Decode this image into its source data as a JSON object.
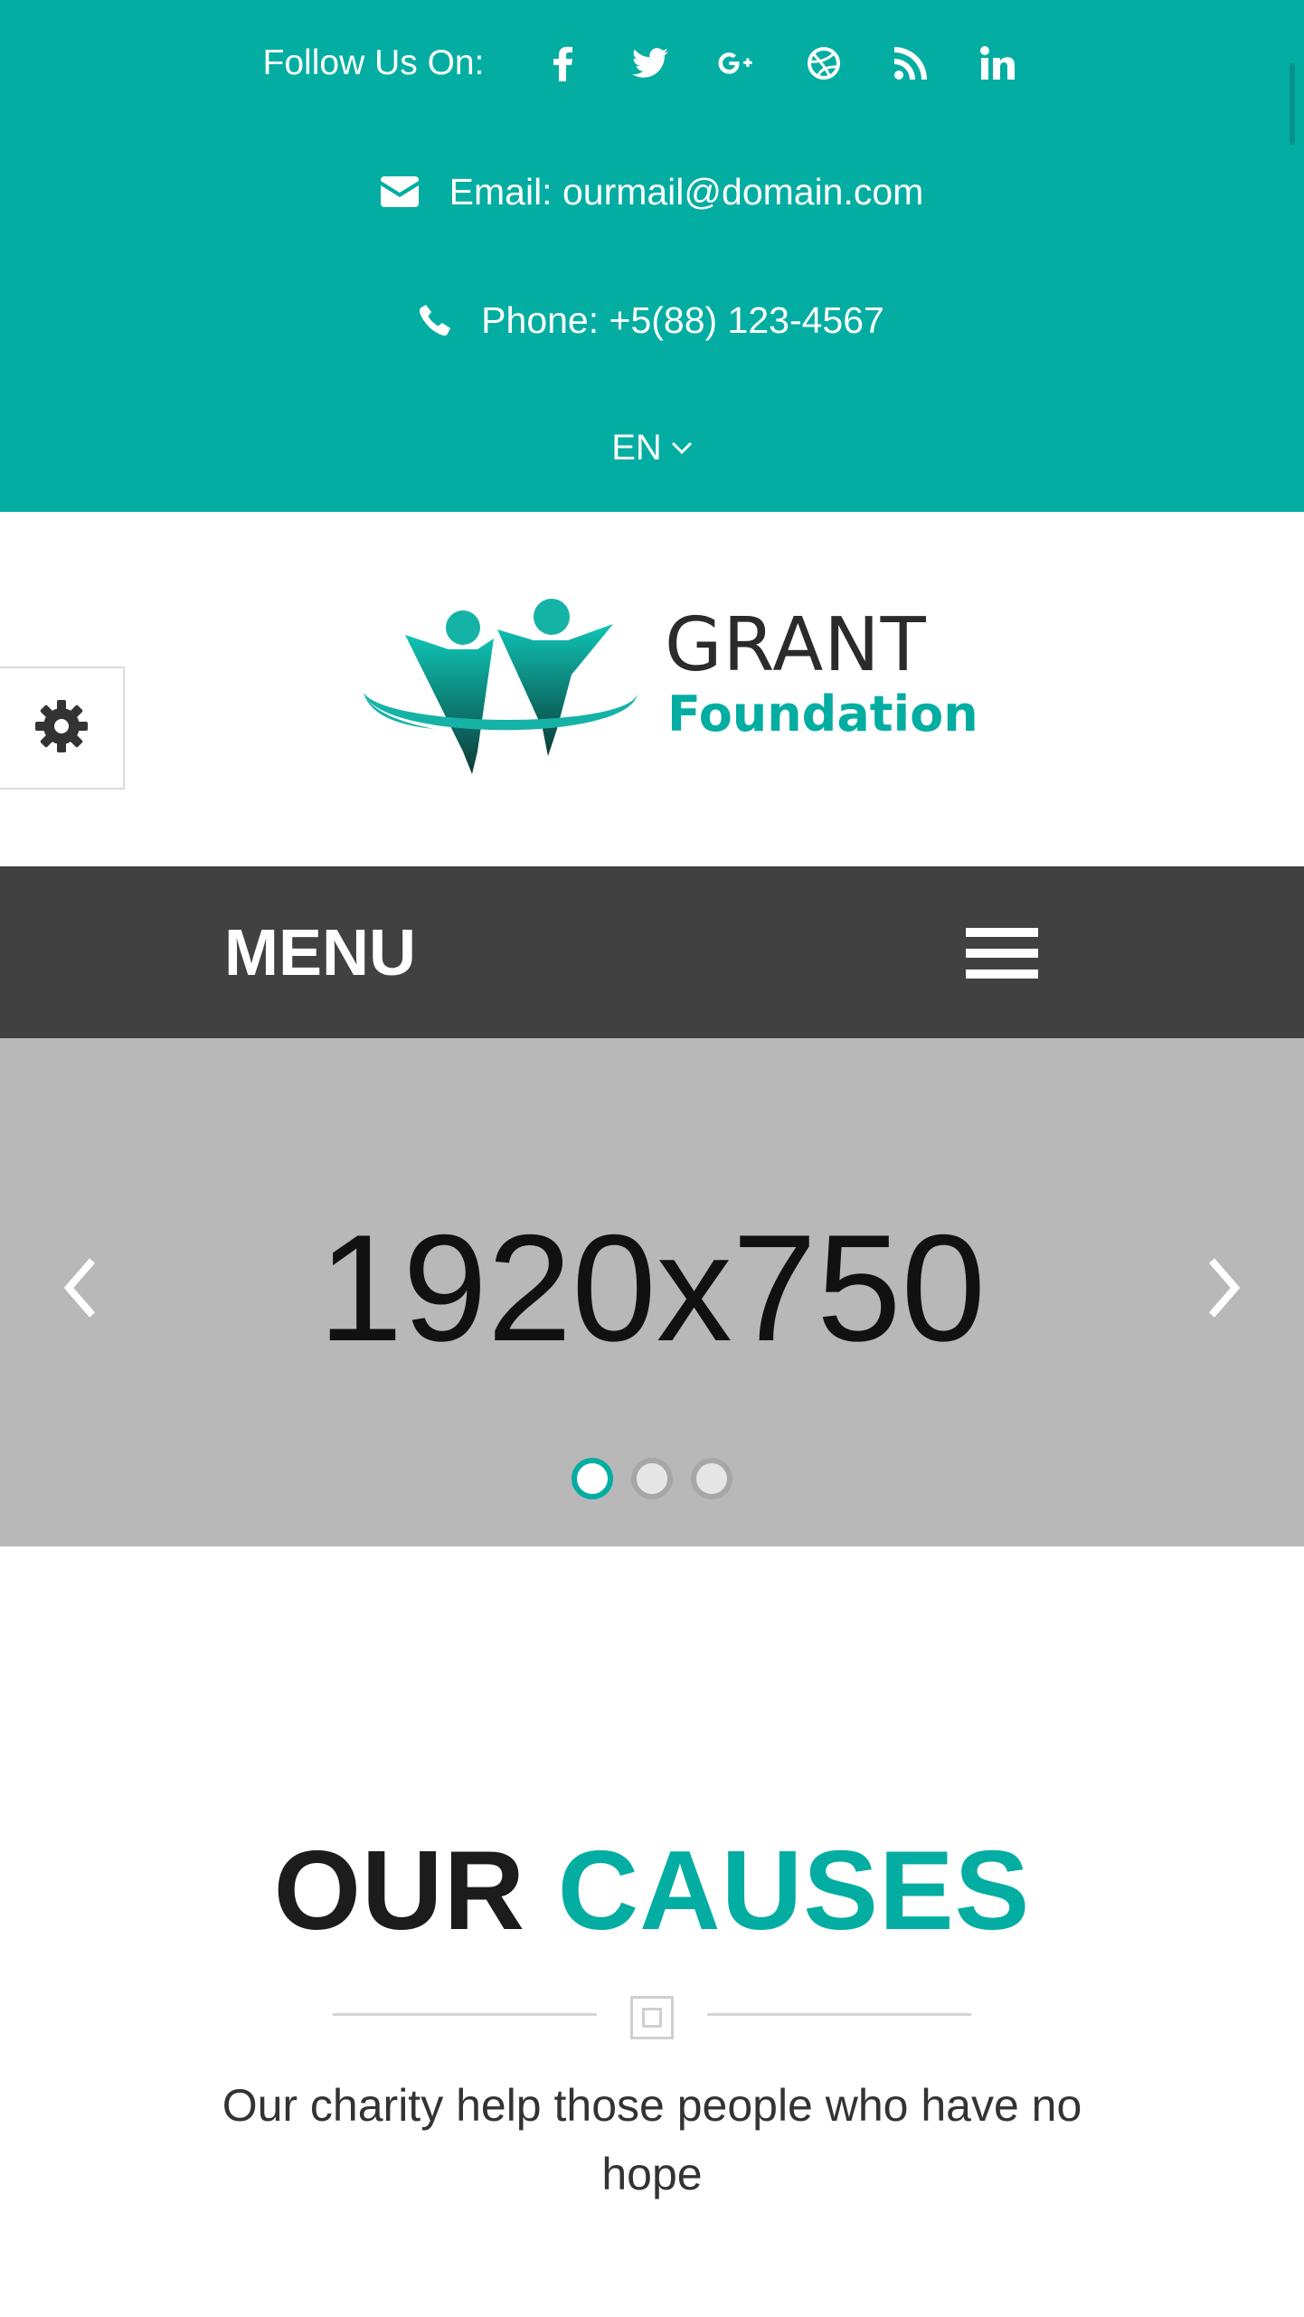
{
  "topbar": {
    "follow_label": "Follow Us On:",
    "social_icons": [
      "facebook-icon",
      "twitter-icon",
      "google-plus-icon",
      "dribbble-icon",
      "rss-icon",
      "linkedin-icon"
    ],
    "email_text": "Email: ourmail@domain.com",
    "phone_text": "Phone: +5(88) 123-4567",
    "language": "EN",
    "background": "#03ada2"
  },
  "logo": {
    "line1": "GRANT",
    "line2": "Foundation"
  },
  "menu": {
    "label": "MENU",
    "background": "#414141"
  },
  "slider": {
    "placeholder_text": "1920x750",
    "dot_count": 3,
    "active_dot": 1,
    "background": "#b8b8b8"
  },
  "causes": {
    "title_part1": "OUR",
    "title_part2": "CAUSES",
    "subtitle": "Our charity help those people who have no hope",
    "accent": "#03ada2"
  }
}
